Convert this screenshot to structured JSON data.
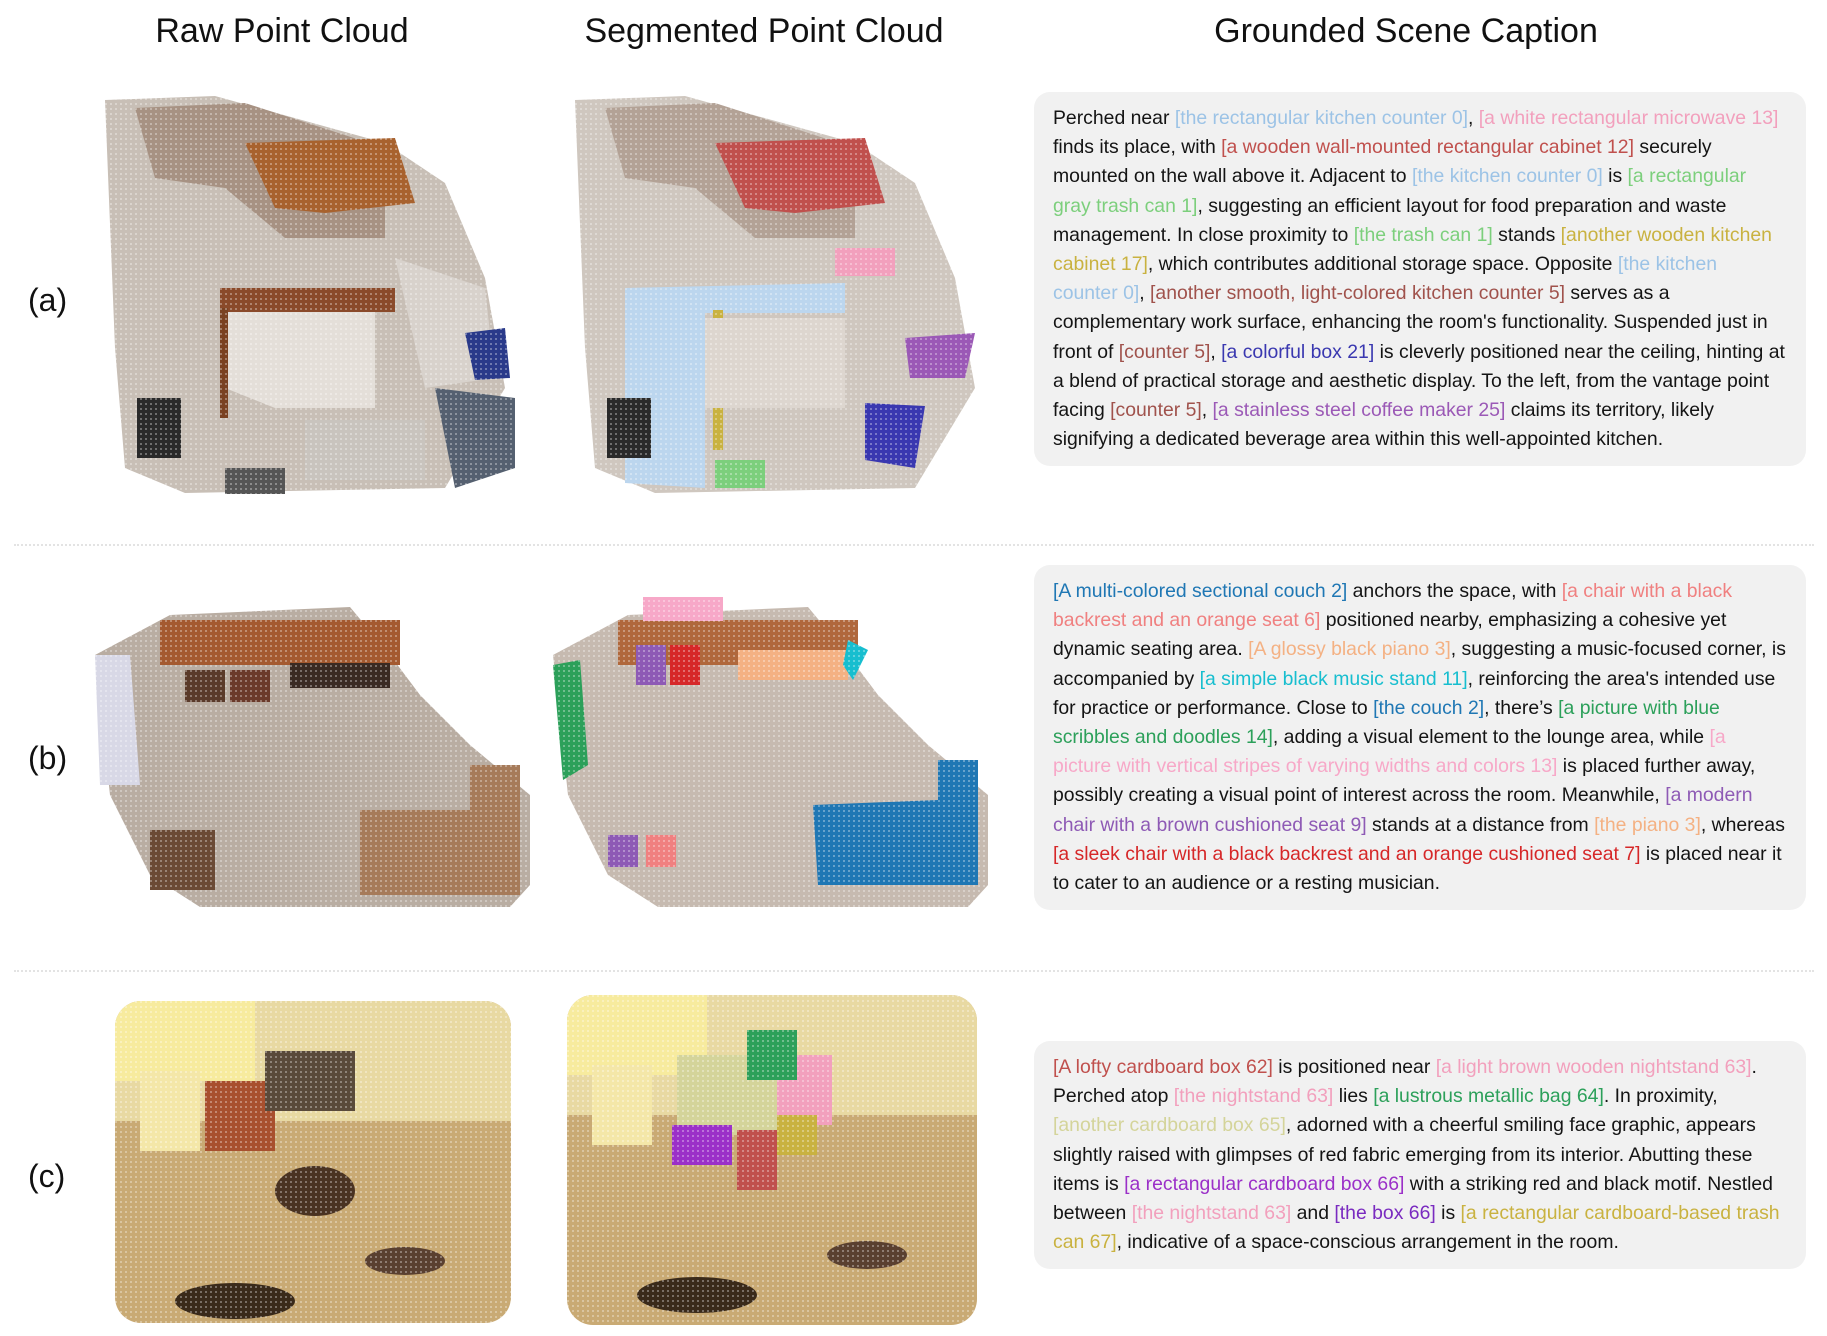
{
  "headers": {
    "raw": "Raw Point Cloud",
    "segmented": "Segmented Point Cloud",
    "caption": "Grounded Scene Caption"
  },
  "rows": [
    {
      "label": "(a)",
      "segments": [
        {
          "t": "[the rectangular kitchen counter 0]",
          "c": "#9cc3e6",
          "pre": "Perched near "
        },
        {
          "t": "[a white rectangular microwave 13]",
          "c": "#f2a0bd",
          "pre": ", "
        },
        {
          "t": "[a wooden wall-mounted rectangular cabinet 12]",
          "c": "#c0504d",
          "pre": " finds its place, with "
        },
        {
          "t": "[the kitchen counter 0]",
          "c": "#9cc3e6",
          "pre": " securely mounted on the wall above it. Adjacent to "
        },
        {
          "t": "[a rectangular gray trash can 1]",
          "c": "#7ccf7c",
          "pre": " is "
        },
        {
          "t": "[the trash can 1]",
          "c": "#7ccf7c",
          "pre": ", suggesting an efficient layout for food preparation and waste management. In close proximity to "
        },
        {
          "t": "[another wooden kitchen cabinet 17]",
          "c": "#c9b240",
          "pre": " stands "
        },
        {
          "t": "[the kitchen counter 0]",
          "c": "#9cc3e6",
          "pre": ", which contributes additional storage space. Opposite "
        },
        {
          "t": "[another smooth, light-colored kitchen counter 5]",
          "c": "#a0524c",
          "pre": ", "
        },
        {
          "t": "[counter 5]",
          "c": "#a0524c",
          "pre": " serves as a complementary work surface, enhancing the room's functionality. Suspended just in front of "
        },
        {
          "t": "[a colorful box 21]",
          "c": "#3a38b0",
          "pre": ", "
        },
        {
          "t": "[counter 5]",
          "c": "#a0524c",
          "pre": " is cleverly positioned near the ceiling, hinting at a blend of practical storage and aesthetic display. To the left, from the vantage point facing "
        },
        {
          "t": "[a stainless steel coffee maker 25]",
          "c": "#9b59b6",
          "pre": ", "
        }
      ],
      "tail": " claims its territory, likely signifying a dedicated beverage area within this well-appointed kitchen."
    },
    {
      "label": "(b)",
      "segments": [
        {
          "t": "[A multi-colored sectional couch 2]",
          "c": "#1f77b4",
          "pre": ""
        },
        {
          "t": "[a chair with a black backrest and an orange seat  6]",
          "c": "#f08080",
          "pre": " anchors the space, with "
        },
        {
          "t": "[A glossy black piano 3]",
          "c": "#f4b183",
          "pre": " positioned nearby, emphasizing a cohesive yet dynamic seating area. "
        },
        {
          "t": "[a simple black music stand 11]",
          "c": "#17becf",
          "pre": ", suggesting a music-focused corner, is accompanied by "
        },
        {
          "t": "[the couch 2]",
          "c": "#1f77b4",
          "pre": ", reinforcing the area's intended use for practice or performance. Close to "
        },
        {
          "t": "[a picture with blue scribbles and doodles 14]",
          "c": "#2ca05a",
          "pre": ", there’s "
        },
        {
          "t": "[a picture with vertical stripes of varying widths and colors 13]",
          "c": "#f7a8c8",
          "pre": ", adding a visual element to the lounge area, while "
        },
        {
          "t": "[a modern chair with a brown cushioned seat 9]",
          "c": "#8e5ab5",
          "pre": " is placed further away, possibly creating a visual point of interest across the room. Meanwhile, "
        },
        {
          "t": "[the piano 3]",
          "c": "#f4b183",
          "pre": " stands at a distance from "
        },
        {
          "t": "[a sleek chair with a black backrest and an orange cushioned seat 7]",
          "c": "#d62728",
          "pre": ", whereas "
        }
      ],
      "tail": " is placed near it to cater to an audience or a resting musician."
    },
    {
      "label": "(c)",
      "segments": [
        {
          "t": "[A lofty cardboard box 62]",
          "c": "#c0504d",
          "pre": ""
        },
        {
          "t": "[a light brown wooden nightstand 63]",
          "c": "#f2a0bd",
          "pre": " is positioned near "
        },
        {
          "t": "[the nightstand 63]",
          "c": "#f2a0bd",
          "pre": ". Perched atop "
        },
        {
          "t": "[a lustrous metallic bag 64]",
          "c": "#2ca05a",
          "pre": " lies "
        },
        {
          "t": "[another cardboard box 65]",
          "c": "#d4d49a",
          "pre": ". In proximity, "
        },
        {
          "t": "[a rectangular cardboard box 66]",
          "c": "#9b30c8",
          "pre": ", adorned with a cheerful smiling face graphic, appears slightly raised with glimpses of red fabric emerging from its interior. Abutting these items is "
        },
        {
          "t": "[the nightstand 63]",
          "c": "#f2a0bd",
          "pre": " with a striking red and black motif. Nestled between "
        },
        {
          "t": "[the box 66]",
          "c": "#7a2bc0",
          "pre": " and "
        },
        {
          "t": "[a rectangular cardboard-based trash can 67]",
          "c": "#c9b240",
          "pre": " is "
        }
      ],
      "tail": ", indicative of a space-conscious arrangement in the room."
    }
  ]
}
